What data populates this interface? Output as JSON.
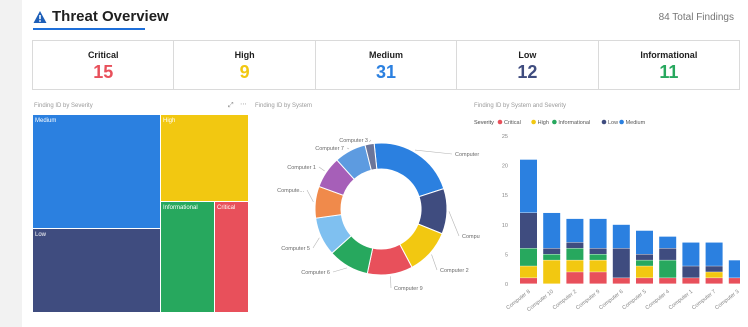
{
  "header": {
    "title": "Threat Overview",
    "total_findings": "84 Total Findings"
  },
  "stats": [
    {
      "label": "Critical",
      "value": "15",
      "color": "#e8505b"
    },
    {
      "label": "High",
      "value": "9",
      "color": "#f2c811"
    },
    {
      "label": "Medium",
      "value": "31",
      "color": "#2b80e0"
    },
    {
      "label": "Low",
      "value": "12",
      "color": "#3f4c7f"
    },
    {
      "label": "Informational",
      "value": "11",
      "color": "#27a85e"
    }
  ],
  "treemap": {
    "title": "Finding ID by Severity",
    "labels": {
      "medium": "Medium",
      "high": "High",
      "informational": "Informational",
      "critical": "Critical",
      "low": "Low"
    }
  },
  "donut": {
    "title": "Finding ID by System",
    "labels": [
      "Computer 8",
      "Compute...",
      "Computer 2",
      "Computer 9",
      "Computer 6",
      "Computer 5",
      "Compute...",
      "Computer 1",
      "Computer 7",
      "Computer 3"
    ]
  },
  "chart_data": {
    "type": "bar",
    "title": "Finding ID by System and Severity",
    "legend_title": "Severity",
    "legend_placement": "top-left",
    "categories": [
      "Computer 8",
      "Computer 10",
      "Computer 2",
      "Computer 9",
      "Computer 6",
      "Computer 5",
      "Computer 4",
      "Computer 1",
      "Computer 7",
      "Computer 3"
    ],
    "series": [
      {
        "name": "Critical",
        "color": "#e8505b",
        "values": [
          1,
          0,
          2,
          2,
          1,
          1,
          1,
          1,
          1,
          1
        ]
      },
      {
        "name": "High",
        "color": "#f2c811",
        "values": [
          2,
          4,
          2,
          2,
          0,
          2,
          0,
          0,
          1,
          0
        ]
      },
      {
        "name": "Informational",
        "color": "#27a85e",
        "values": [
          3,
          1,
          2,
          1,
          0,
          1,
          3,
          0,
          0,
          0
        ]
      },
      {
        "name": "Low",
        "color": "#3f4c7f",
        "values": [
          6,
          1,
          1,
          1,
          5,
          1,
          2,
          2,
          1,
          0
        ]
      },
      {
        "name": "Medium",
        "color": "#2b80e0",
        "values": [
          9,
          6,
          4,
          5,
          4,
          4,
          2,
          4,
          4,
          3
        ]
      }
    ],
    "ylim": [
      0,
      25
    ],
    "yticks": [
      "0",
      "5",
      "10",
      "15",
      "20",
      "25"
    ],
    "grid": false
  }
}
